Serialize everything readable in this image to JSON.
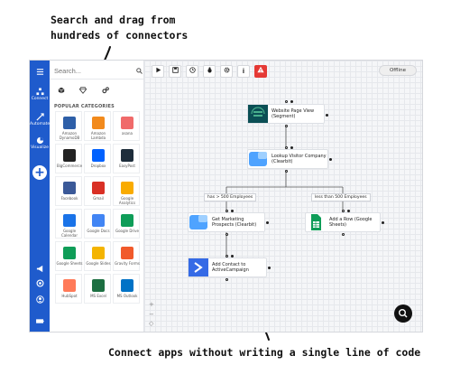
{
  "captions": {
    "top_line1": "Search and drag from",
    "top_line2": "hundreds of connectors",
    "bottom": "Connect apps without writing a single line of code"
  },
  "rail": {
    "items": [
      {
        "label": "Connect",
        "icon": "connect-icon"
      },
      {
        "label": "Automate",
        "icon": "automate-icon"
      },
      {
        "label": "Visualize",
        "icon": "visualize-icon"
      }
    ]
  },
  "panel": {
    "search_placeholder": "Search...",
    "category_heading": "POPULAR CATEGORIES",
    "connectors": [
      {
        "name": "Amazon DynamoDB",
        "color": "#2e5fa8"
      },
      {
        "name": "Amazon Lambda",
        "color": "#f28a1c"
      },
      {
        "name": "asana",
        "color": "#f06a6a"
      },
      {
        "name": "BigCommerce",
        "color": "#222222"
      },
      {
        "name": "Dropbox",
        "color": "#0061fe"
      },
      {
        "name": "EasyPost",
        "color": "#1e2d3b"
      },
      {
        "name": "Facebook",
        "color": "#3b5998"
      },
      {
        "name": "Gmail",
        "color": "#d93025"
      },
      {
        "name": "Google Analytics",
        "color": "#f9ab00"
      },
      {
        "name": "Google Calendar",
        "color": "#1a73e8"
      },
      {
        "name": "Google Docs",
        "color": "#4285f4"
      },
      {
        "name": "Google Drive",
        "color": "#0f9d58"
      },
      {
        "name": "Google Sheets",
        "color": "#0f9d58"
      },
      {
        "name": "Google Slides",
        "color": "#f4b400"
      },
      {
        "name": "Gravity Forms",
        "color": "#f15a2b"
      },
      {
        "name": "HubSpot",
        "color": "#ff7a59"
      },
      {
        "name": "MS Excel",
        "color": "#1d6f42"
      },
      {
        "name": "MS Outlook",
        "color": "#0072c6"
      }
    ]
  },
  "canvas": {
    "status": "Offline",
    "nodes": {
      "segment": "Website Page View (Segment)",
      "clearbit_lookup": "Lookup Visitor Company (Clearbit)",
      "clearbit_prospects": "Get Marketing Prospects (Clearbit)",
      "sheets": "Add a Row (Google Sheets)",
      "activecampaign": "Add Contact to ActiveCampaign"
    },
    "conditions": {
      "left": "has > 500 Employees",
      "right": "less than 500 Employees"
    },
    "toolbar_info": "i"
  }
}
